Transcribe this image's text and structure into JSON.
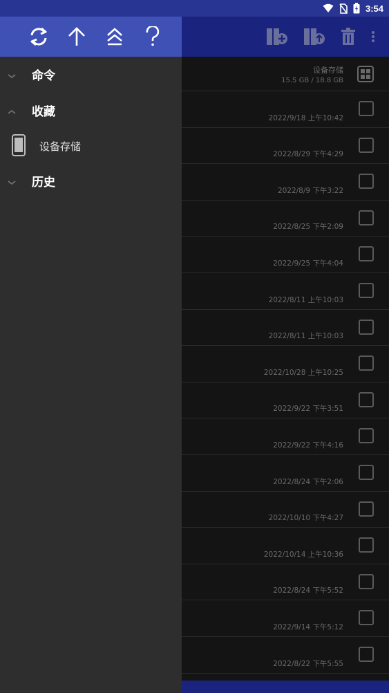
{
  "status_bar": {
    "time": "3:54"
  },
  "drawer": {
    "header_icons": [
      "refresh-icon",
      "arrow-up-icon",
      "double-chevron-up-icon",
      "help-icon"
    ],
    "sections": {
      "commands": "命令",
      "favorites": "收藏",
      "favorite_item": "设备存储",
      "history": "历史"
    }
  },
  "toolbar": {
    "icons": [
      "add-folder-icon",
      "upload-folder-icon",
      "trash-icon",
      "more-vert-icon"
    ]
  },
  "storage": {
    "name": "设备存储",
    "size": "15.5 GB / 18.8 GB"
  },
  "rows": [
    {
      "date": "2022/9/18 上午10:42"
    },
    {
      "date": "2022/8/29 下午4:29"
    },
    {
      "date": "2022/8/9 下午3:22"
    },
    {
      "date": "2022/8/25 下午2:09"
    },
    {
      "date": "2022/9/25 下午4:04"
    },
    {
      "date": "2022/8/11 上午10:03"
    },
    {
      "date": "2022/8/11 上午10:03"
    },
    {
      "date": "2022/10/28 上午10:25"
    },
    {
      "date": "2022/9/22 下午3:51"
    },
    {
      "date": "2022/9/22 下午4:16"
    },
    {
      "date": "2022/8/24 下午2:06"
    },
    {
      "date": "2022/10/10 下午4:27"
    },
    {
      "date": "2022/10/14 上午10:36"
    },
    {
      "date": "2022/8/24 下午5:52"
    },
    {
      "date": "2022/9/14 下午5:12"
    },
    {
      "date": "2022/8/22 下午5:55"
    }
  ],
  "colors": {
    "drawer_header": "#3f51b5",
    "status_bar": "#283593",
    "drawer_bg": "#2e2e2e",
    "list_bg": "#141414"
  }
}
